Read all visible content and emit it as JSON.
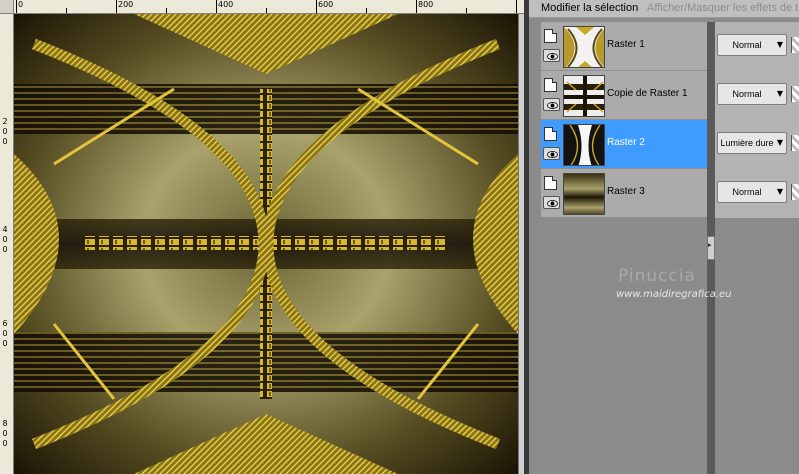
{
  "canvas": {
    "ruler_labels": [
      "0",
      "200",
      "400",
      "600",
      "800"
    ],
    "vruler_labels": [
      "2",
      "0",
      "0",
      "4",
      "0",
      "0",
      "6",
      "0",
      "0",
      "8",
      "0",
      "0"
    ],
    "image_name": "canvas-image"
  },
  "layers_panel": {
    "toolbar": {
      "modify_selection": "Modifier la sélection",
      "toggle_effects": "Afficher/Masquer les effets de t"
    },
    "layers": [
      {
        "name": "Raster 1",
        "blend": "Normal"
      },
      {
        "name": "Copie de Raster 1",
        "blend": "Normal"
      },
      {
        "name": "Raster 2",
        "blend": "Lumière dure"
      },
      {
        "name": "Raster 3",
        "blend": "Normal"
      }
    ],
    "selected_index": 2
  },
  "watermark": {
    "name": "Pinuccia",
    "url": "www.maidiregrafica.eu"
  },
  "colors": {
    "selection": "#3f9bff",
    "gold": "#c9a826",
    "dark": "#1c1505",
    "olive": "#8f8750"
  }
}
